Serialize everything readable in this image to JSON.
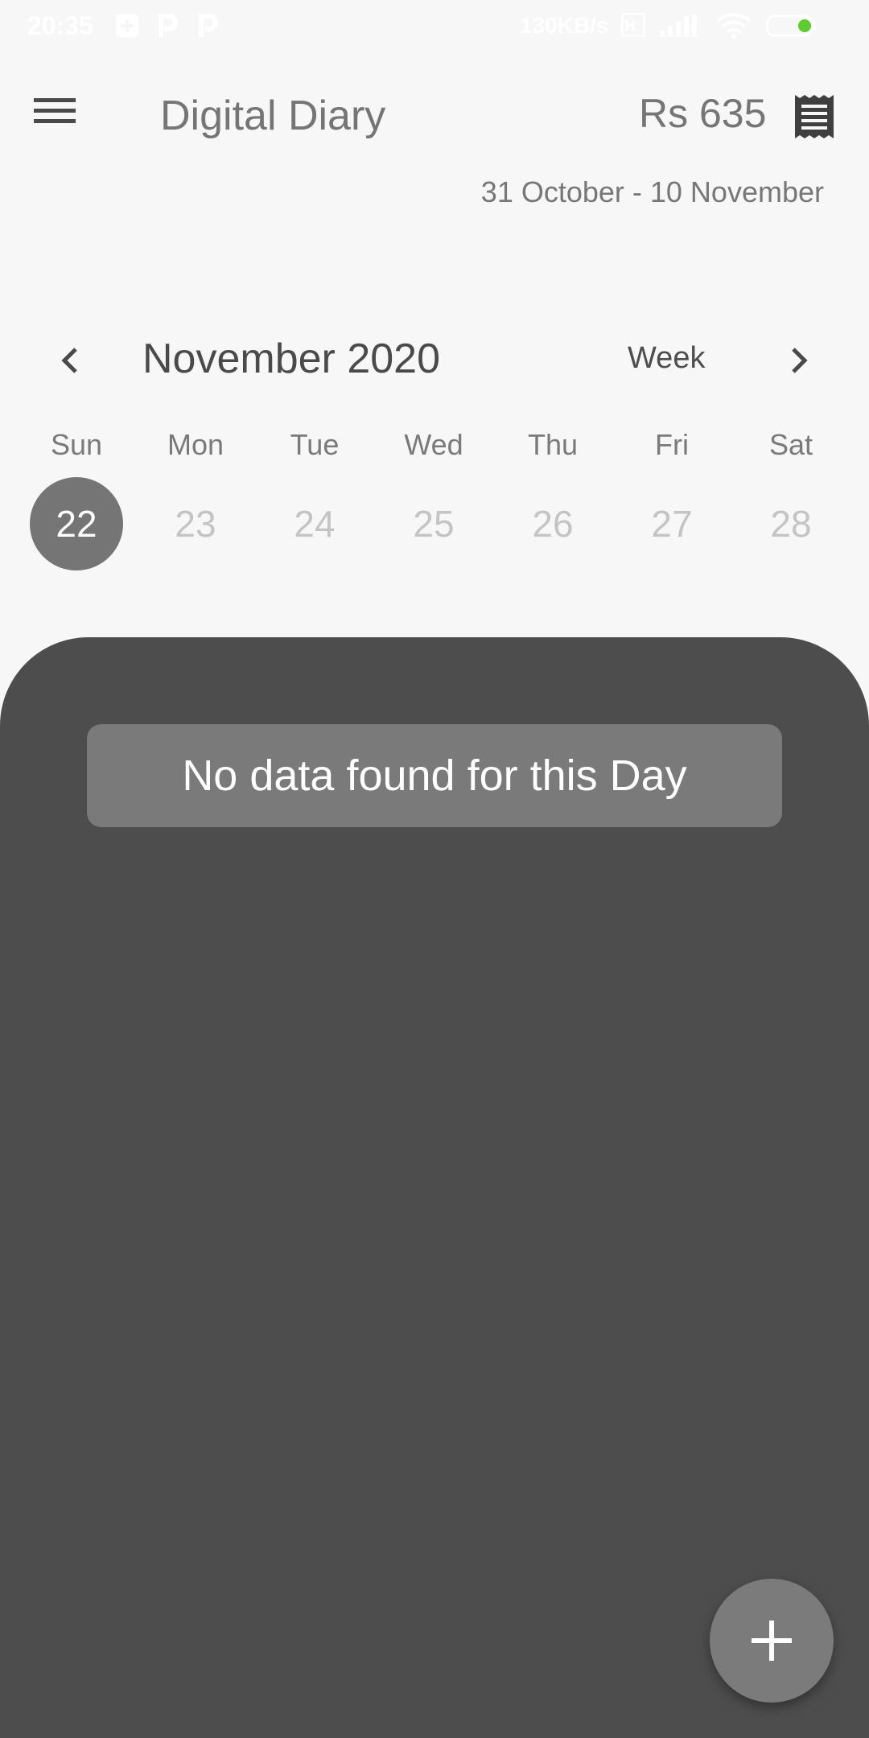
{
  "status_bar": {
    "time": "20:35",
    "network_speed": "130KB/s",
    "battery_level": "39",
    "icons": [
      "plus-box-icon",
      "p-icon",
      "p-icon",
      "hd-icon",
      "signal-icon",
      "wifi-icon",
      "battery-icon"
    ]
  },
  "appbar": {
    "menu_icon": "hamburger-menu-icon",
    "title": "Digital Diary",
    "balance": "Rs 635",
    "receipt_icon": "receipt-icon"
  },
  "date_range": "31 October - 10 November",
  "calendar": {
    "month_label": "November 2020",
    "format_button": "Week",
    "prev_icon": "chevron-left-icon",
    "next_icon": "chevron-right-icon",
    "days_of_week": [
      "Sun",
      "Mon",
      "Tue",
      "Wed",
      "Thu",
      "Fri",
      "Sat"
    ],
    "days": [
      "22",
      "23",
      "24",
      "25",
      "26",
      "27",
      "28"
    ],
    "selected_day": "22"
  },
  "empty_message": "No data found for this Day",
  "fab_icon": "plus-icon",
  "colors": {
    "background": "#f7f7f7",
    "panel": "#4d4d4d",
    "accent_grey": "#757575",
    "message_box": "#7a7a7a"
  }
}
